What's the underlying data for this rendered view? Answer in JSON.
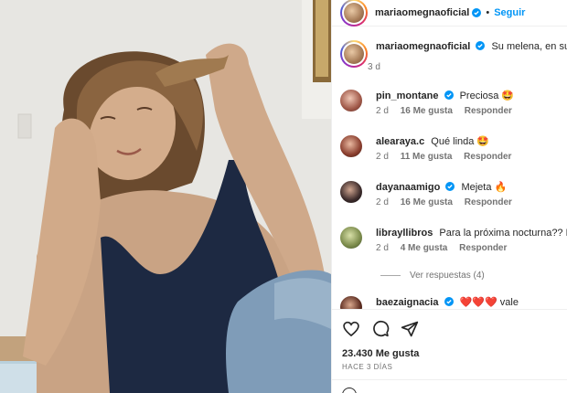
{
  "post": {
    "author": "mariaomegnaoficial",
    "follow_label": "Seguir",
    "separator": "•",
    "caption_text": "Su melena, en su sáb",
    "caption_time": "3 d"
  },
  "comments": [
    {
      "user": "pin_montane",
      "text": "Preciosa 🤩",
      "time": "2 d",
      "likes": "16 Me gusta",
      "reply": "Responder",
      "verified": true
    },
    {
      "user": "alearaya.c",
      "text": "Qué linda 🤩",
      "time": "2 d",
      "likes": "11 Me gusta",
      "reply": "Responder",
      "verified": false
    },
    {
      "user": "dayanaamigo",
      "text": "Mejeta 🔥",
      "time": "2 d",
      "likes": "16 Me gusta",
      "reply": "Responder",
      "verified": true
    },
    {
      "user": "librayllibros",
      "text": "Para la próxima nocturna?? Di qu",
      "time": "2 d",
      "likes": "4 Me gusta",
      "reply": "Responder",
      "verified": false
    },
    {
      "user": "baezaignacia",
      "text": "❤️❤️❤️ vale",
      "time": "",
      "likes": "",
      "reply": "",
      "verified": true
    }
  ],
  "view_replies": "Ver respuestas (4)",
  "actions": {
    "likes_count": "23.430 Me gusta",
    "posted_ago": "HACE 3 DÍAS",
    "icons": [
      "heart-icon",
      "comment-icon",
      "share-icon"
    ]
  },
  "colors": {
    "accent": "#0095f6",
    "verified": "#0095f6",
    "secondary_text": "#737373"
  }
}
